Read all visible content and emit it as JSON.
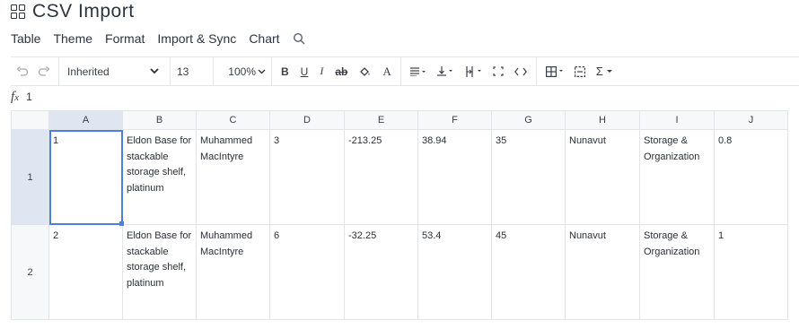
{
  "app": {
    "title": "CSV Import"
  },
  "menu": {
    "items": [
      "Table",
      "Theme",
      "Format",
      "Import & Sync",
      "Chart"
    ]
  },
  "toolbar": {
    "font": "Inherited",
    "font_size": "13",
    "zoom": "100%",
    "bold": "B",
    "underline": "U",
    "italic": "I",
    "strike": "ab",
    "text_color": "A",
    "sum": "Σ"
  },
  "formula": {
    "value": "1"
  },
  "grid": {
    "columns": [
      "A",
      "B",
      "C",
      "D",
      "E",
      "F",
      "G",
      "H",
      "I",
      "J"
    ],
    "rows": [
      {
        "header": "1",
        "cells": [
          "1",
          "Eldon Base for stackable storage shelf, platinum",
          "Muhammed MacIntyre",
          "3",
          "-213.25",
          "38.94",
          "35",
          "Nunavut",
          "Storage & Organization",
          "0.8"
        ]
      },
      {
        "header": "2",
        "cells": [
          "2",
          "Eldon Base for stackable storage shelf, platinum",
          "Muhammed MacIntyre",
          "6",
          "-32.25",
          "53.4",
          "45",
          "Nunavut",
          "Storage & Organization",
          "1"
        ]
      }
    ]
  },
  "colors": {
    "accent": "#4a7ee0",
    "selected_header": "#dfe6f2"
  }
}
